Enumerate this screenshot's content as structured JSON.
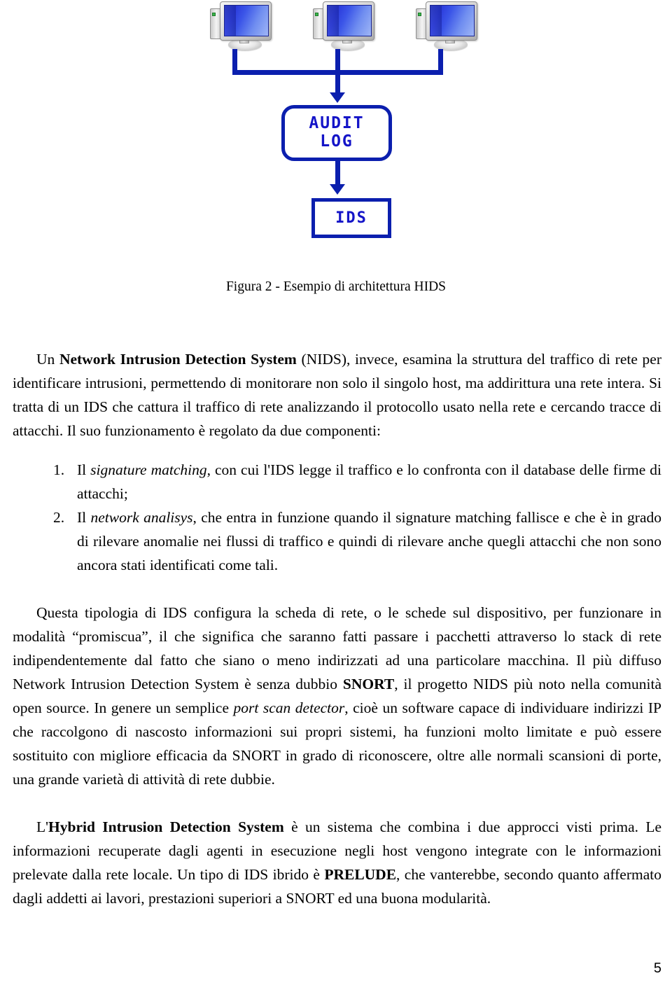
{
  "figure": {
    "alt_name": "HIDS architecture diagram",
    "hosts": [
      {
        "label": "host-1"
      },
      {
        "label": "host-2"
      },
      {
        "label": "host-3"
      }
    ],
    "audit_box": {
      "line1": "AUDIT",
      "line2": "LOG"
    },
    "ids_box": {
      "line1": "IDS"
    },
    "colors": {
      "line": "#0b1fae",
      "box_border": "#0b1fae",
      "box_text": "#1414c8",
      "screen": "#2c3ddd"
    },
    "caption": "Figura 2 -  Esempio di architettura HIDS"
  },
  "content": {
    "para_nids": {
      "lead_plain": "Un ",
      "lead_bold": "Network Intrusion Detection System",
      "rest": " (NIDS), invece, esamina la struttura del traffico di rete per identificare intrusioni, permettendo di monitorare non solo il singolo host, ma addirittura una rete intera. Si tratta di un IDS che cattura il traffico di rete analizzando il protocollo usato nella rete e cercando tracce di attacchi. Il suo funzionamento è regolato da due componenti:"
    },
    "components": [
      {
        "number": "1.",
        "pre": "Il ",
        "italic": "signature matching",
        "post": ", con cui l'IDS legge il traffico e lo confronta con il database delle firme di attacchi;"
      },
      {
        "number": "2.",
        "pre": "Il ",
        "italic": "network analisys",
        "post": ", che entra in funzione quando il signature matching fallisce e che è in grado di rilevare anomalie nei flussi di traffico e quindi di rilevare anche quegli attacchi che non sono ancora stati identificati come tali."
      }
    ],
    "para_promiscua": {
      "seg1": "Questa tipologia di IDS configura la scheda di rete, o le schede sul dispositivo, per funzionare in modalità “promiscua”, il che significa che saranno fatti passare i pacchetti attraverso lo stack di rete indipendentemente dal fatto che siano o meno indirizzati ad una particolare macchina. Il più diffuso Network Intrusion Detection System è senza dubbio ",
      "bold1": "SNORT",
      "seg2": ", il progetto NIDS più noto nella comunità open source. In genere un semplice ",
      "italic1": "port scan detector",
      "seg3": ", cioè un software capace di individuare indirizzi IP che raccolgono di nascosto informazioni sui propri sistemi, ha funzioni molto limitate e può essere sostituito con migliore efficacia da SNORT in grado di riconoscere, oltre alle normali scansioni di porte, una grande varietà di attività di rete dubbie."
    },
    "para_hybrid": {
      "seg1": "L'",
      "bold1": "Hybrid Intrusion Detection System",
      "seg2": " è un sistema che combina i due approcci visti prima. Le informazioni recuperate dagli agenti in esecuzione negli host vengono integrate con le informazioni prelevate dalla rete locale. Un tipo di IDS ibrido è ",
      "bold2": "PRELUDE",
      "seg3": ", che vanterebbe, secondo quanto affermato dagli addetti ai lavori, prestazioni superiori a SNORT ed una buona modularità."
    }
  },
  "footer": {
    "page_number": "5"
  }
}
